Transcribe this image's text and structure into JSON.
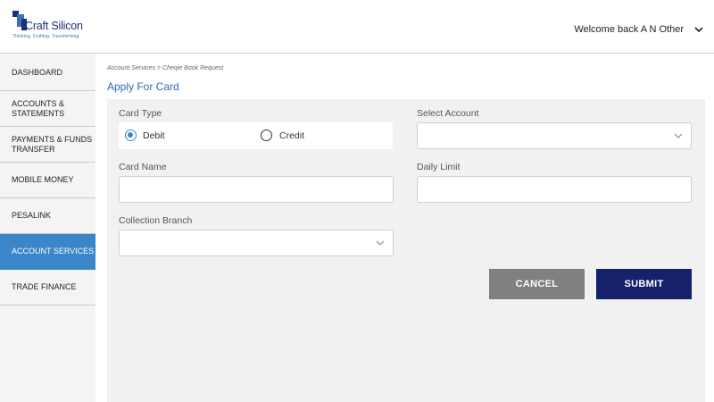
{
  "header": {
    "brand_name": "Craft Silicon",
    "brand_tagline": "Thinking. Crafting. Transforming.",
    "welcome_text": "Welcome back A N Other"
  },
  "sidebar": {
    "items": [
      {
        "label": "DASHBOARD"
      },
      {
        "label": "ACCOUNTS & STATEMENTS"
      },
      {
        "label": "PAYMENTS & FUNDS TRANSFER"
      },
      {
        "label": "MOBILE MONEY"
      },
      {
        "label": "PESALINK"
      },
      {
        "label": "ACCOUNT SERVICES"
      },
      {
        "label": "TRADE FINANCE"
      }
    ],
    "active_index": 5
  },
  "main": {
    "breadcrumb": "Account Services > Cheqie Book Request",
    "title": "Apply For Card",
    "form": {
      "card_type_label": "Card Type",
      "card_type_options": [
        "Debit",
        "Credit"
      ],
      "card_type_selected": "Debit",
      "select_account_label": "Select Account",
      "select_account_value": "",
      "card_name_label": "Card Name",
      "card_name_value": "",
      "daily_limit_label": "Daily Limit",
      "daily_limit_value": "",
      "collection_branch_label": "Collection Branch",
      "collection_branch_value": ""
    },
    "buttons": {
      "cancel": "CANCEL",
      "submit": "SUBMIT"
    }
  },
  "colors": {
    "accent": "#3a86c8",
    "title": "#2a6cb5",
    "submit": "#17206b",
    "cancel": "#808080",
    "brand": "#1e2f7a"
  },
  "icons": {
    "welcome_menu": "chevron-down-icon",
    "select": "chevron-down-icon",
    "logo": "craft-silicon-logo"
  }
}
